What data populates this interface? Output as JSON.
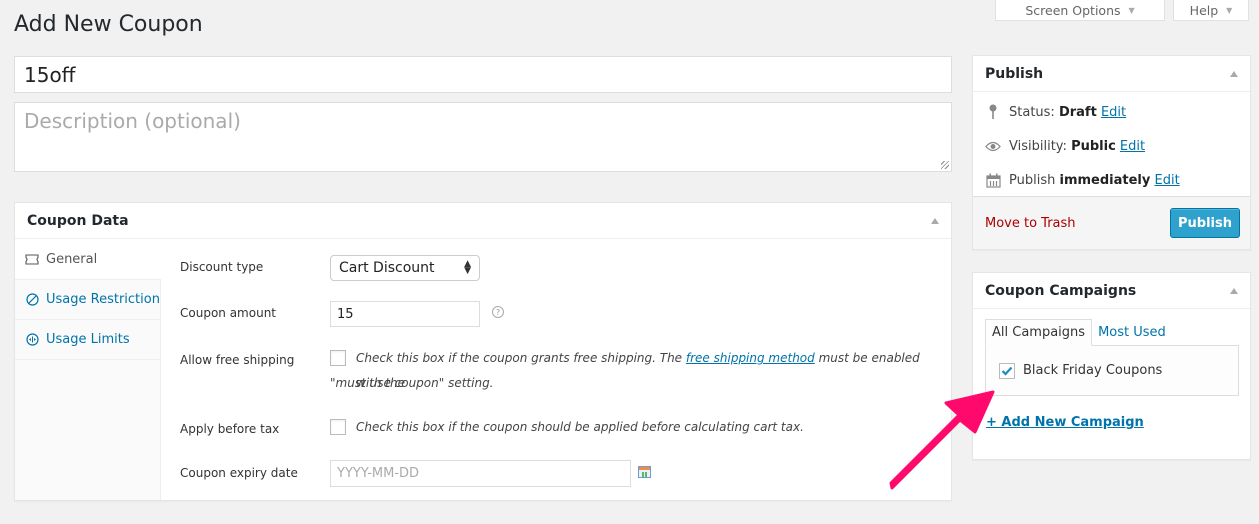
{
  "header": {
    "title": "Add New Coupon",
    "screen_options_label": "Screen Options",
    "help_label": "Help"
  },
  "coupon": {
    "code_value": "15off",
    "description_placeholder": "Description (optional)"
  },
  "coupon_data": {
    "title": "Coupon Data",
    "tabs": [
      {
        "label": "General",
        "icon": "ticket-icon",
        "active": true
      },
      {
        "label": "Usage Restriction",
        "icon": "restriction-icon",
        "active": false
      },
      {
        "label": "Usage Limits",
        "icon": "limits-icon",
        "active": false
      }
    ],
    "fields": {
      "discount_type_label": "Discount type",
      "discount_type_value": "Cart Discount",
      "amount_label": "Coupon amount",
      "amount_value": "15",
      "free_shipping_label": "Allow free shipping",
      "free_shipping_checked": false,
      "free_shipping_desc_pre": "Check this box if the coupon grants free shipping. The ",
      "free_shipping_link": "free shipping method",
      "free_shipping_desc_post": " must be enabled with the",
      "free_shipping_desc_line2": "\"must use coupon\" setting.",
      "before_tax_label": "Apply before tax",
      "before_tax_checked": false,
      "before_tax_desc": "Check this box if the coupon should be applied before calculating cart tax.",
      "expiry_label": "Coupon expiry date",
      "expiry_placeholder": "YYYY-MM-DD"
    }
  },
  "publish": {
    "title": "Publish",
    "status_label": "Status:",
    "status_value": "Draft",
    "visibility_label": "Visibility:",
    "visibility_value": "Public",
    "publish_label": "Publish",
    "publish_value": "immediately",
    "edit_label": "Edit",
    "trash_label": "Move to Trash",
    "publish_button": "Publish"
  },
  "campaigns": {
    "title": "Coupon Campaigns",
    "tabs": [
      "All Campaigns",
      "Most Used"
    ],
    "items": [
      {
        "label": "Black Friday Coupons",
        "checked": true
      }
    ],
    "add_new_label": "+ Add New Campaign"
  },
  "colors": {
    "accent": "#0073aa",
    "publish_button": "#2ea2cc",
    "trash": "#aa0000",
    "annotation_arrow": "#ff0a6c"
  }
}
